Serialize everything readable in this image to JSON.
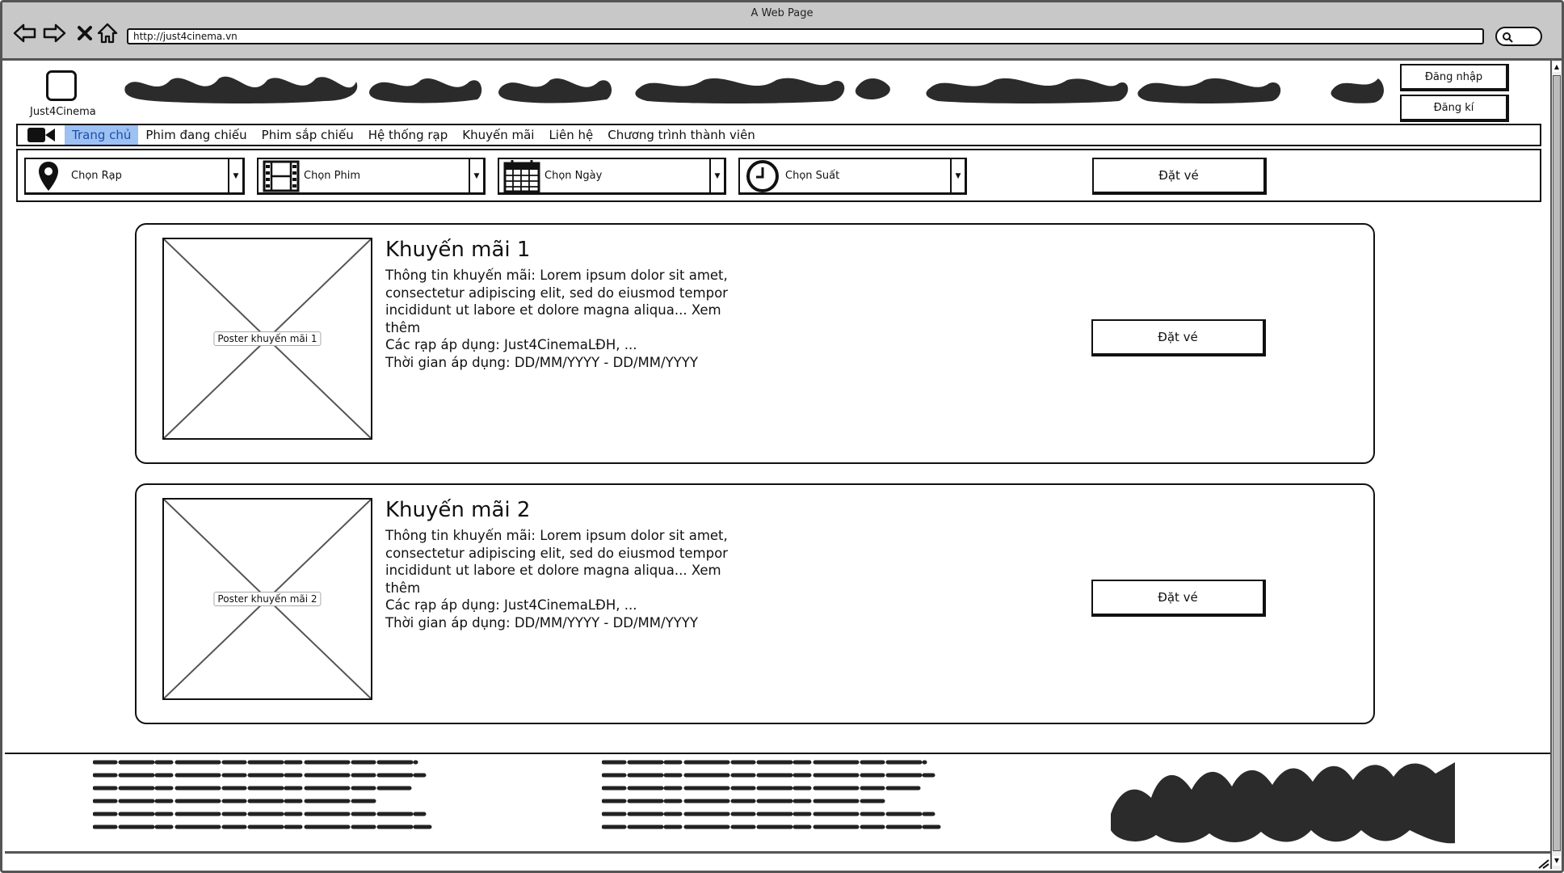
{
  "browser": {
    "title": "A Web Page",
    "url": "http://just4cinema.vn"
  },
  "header": {
    "logo_text": "Just4Cinema",
    "login_label": "Đăng nhập",
    "register_label": "Đăng kí"
  },
  "menu": {
    "items": [
      {
        "label": "Trang chủ",
        "active": true
      },
      {
        "label": "Phim đang chiếu",
        "active": false
      },
      {
        "label": "Phim sắp chiếu",
        "active": false
      },
      {
        "label": "Hệ thống rạp",
        "active": false
      },
      {
        "label": "Khuyến mãi",
        "active": false
      },
      {
        "label": "Liên hệ",
        "active": false
      },
      {
        "label": "Chương trình thành viên",
        "active": false
      }
    ]
  },
  "filters": {
    "theater": {
      "label": "Chọn Rạp",
      "icon": "map-pin-icon"
    },
    "movie": {
      "label": "Chọn Phim",
      "icon": "film-icon"
    },
    "date": {
      "label": "Chọn Ngày",
      "icon": "calendar-icon"
    },
    "showtime": {
      "label": "Chọn Suất",
      "icon": "clock-icon"
    },
    "book_label": "Đặt vé"
  },
  "promos": [
    {
      "title": "Khuyến mãi 1",
      "poster_caption": "Poster khuyến mãi 1",
      "description": "Thông tin khuyến mãi: Lorem ipsum dolor sit amet, consectetur adipiscing elit, sed do eiusmod tempor incididunt ut labore et dolore magna aliqua... Xem thêm",
      "theaters": "Các rạp áp dụng: Just4CinemaLĐH, ...",
      "period": "Thời gian áp dụng: DD/MM/YYYY - DD/MM/YYYY",
      "book_label": "Đặt vé"
    },
    {
      "title": "Khuyến mãi 2",
      "poster_caption": "Poster khuyến mãi 2",
      "description": "Thông tin khuyến mãi: Lorem ipsum dolor sit amet, consectetur adipiscing elit, sed do eiusmod tempor incididunt ut labore et dolore magna aliqua... Xem thêm",
      "theaters": "Các rạp áp dụng: Just4CinemaLĐH, ...",
      "period": "Thời gian áp dụng: DD/MM/YYYY - DD/MM/YYYY",
      "book_label": "Đặt vé"
    }
  ],
  "colors": {
    "menu_active_bg": "#9ec1f4",
    "menu_active_text": "#1e4fa8",
    "chrome": "#c8c8c8",
    "ink": "#111111"
  }
}
